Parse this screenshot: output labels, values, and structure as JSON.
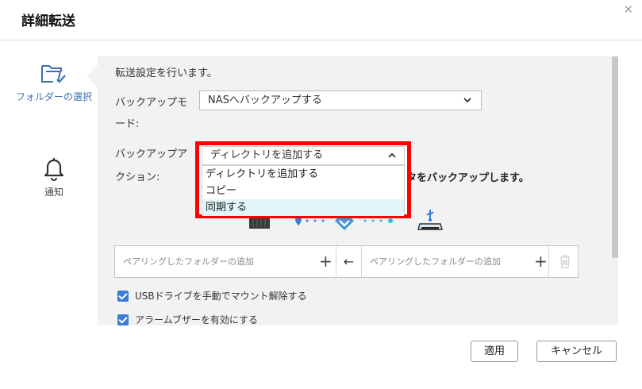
{
  "dialog": {
    "title": "詳細転送",
    "close_glyph": "×"
  },
  "sidebar": {
    "items": [
      {
        "label": "フォルダーの選択",
        "icon": "folder-check-icon",
        "active": true
      },
      {
        "label": "通知",
        "icon": "bell-icon",
        "active": false
      }
    ]
  },
  "main": {
    "intro": "転送設定を行います。",
    "backup_mode_label_line1": "バックアップモ",
    "backup_mode_label_line2": "ード:",
    "backup_mode_value": "NASへバックアップする",
    "backup_action_label_line1": "バックアップア",
    "backup_action_label_line2": "クション:",
    "backup_action_value": "ディレクトリを追加する",
    "backup_action_options": [
      "ディレクトリを追加する",
      "コピー",
      "同期する"
    ],
    "highlighted_option": "同期する",
    "partially_hidden_text": "タをバックアップします。",
    "pairing": {
      "left_placeholder": "ペアリングしたフォルダーの追加",
      "direction_arrow": "←",
      "right_placeholder": "ペアリングしたフォルダーの追加",
      "add_glyph": "+"
    },
    "options": [
      {
        "label": "USBドライブを手動でマウント解除する",
        "checked": true
      },
      {
        "label": "アラームブザーを有効にする",
        "checked": true
      }
    ]
  },
  "footer": {
    "apply_label": "適用",
    "cancel_label": "キャンセル"
  },
  "colors": {
    "accent": "#3a7bd5",
    "highlight_border": "#ff0000",
    "selected_option_bg": "#e1f6f8",
    "panel_bg": "#f2f2f2"
  }
}
